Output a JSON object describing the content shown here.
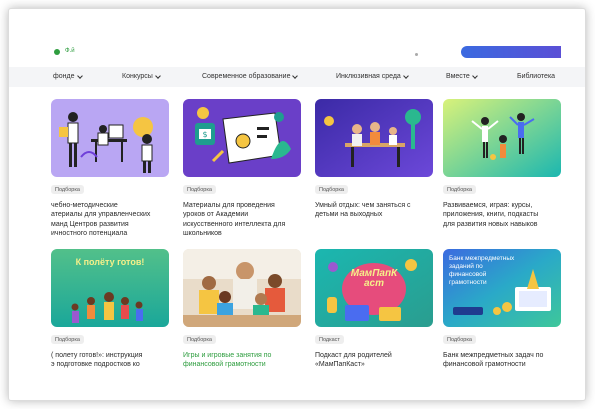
{
  "header": {
    "logo_text": "Ф.й"
  },
  "nav": {
    "items": [
      {
        "label": "фонде"
      },
      {
        "label": "Конкурсы"
      },
      {
        "label": "Современное образование"
      },
      {
        "label": "Инклюзивная среда"
      },
      {
        "label": "Вместе"
      },
      {
        "label": "Библиотека"
      }
    ]
  },
  "cards": [
    {
      "tag": "Подборка",
      "title": "чебно-методические\nатериалы для управленческих\nманд Центров развития\nичностного потенциала"
    },
    {
      "tag": "Подборка",
      "title": "Материалы для проведения\nуроков от Академии\nискусственного интеллекта для\nшкольников"
    },
    {
      "tag": "Подборка",
      "title": "Умный отдых: чем заняться с\nдетьми на выходных"
    },
    {
      "tag": "Подборка",
      "title": "Развиваемся, играя: курсы,\nприложения, книги, подкасты\nдля развития новых навыков"
    },
    {
      "tag": "Подборка",
      "title": "( полету готов!»: инструкция\nэ подготовке подростков ко",
      "banner": "К полёту готов!"
    },
    {
      "tag": "Подборка",
      "title": "Игры и игровые занятия по\nфинансовой грамотности"
    },
    {
      "tag": "Подкаст",
      "title": "Подкаст для родителей\n«МамПапКаст»",
      "banner": "МамПапКаст"
    },
    {
      "tag": "Подборка",
      "title": "Банк межпредметных задач по\nфинансовой грамотности",
      "banner": "Банк межпредметных\nзаданий по финансовой\nграмотности"
    }
  ],
  "colors": {
    "accent_green": "#2e9d3f",
    "purple": "#6f3fd9",
    "teal": "#1aa79a"
  }
}
